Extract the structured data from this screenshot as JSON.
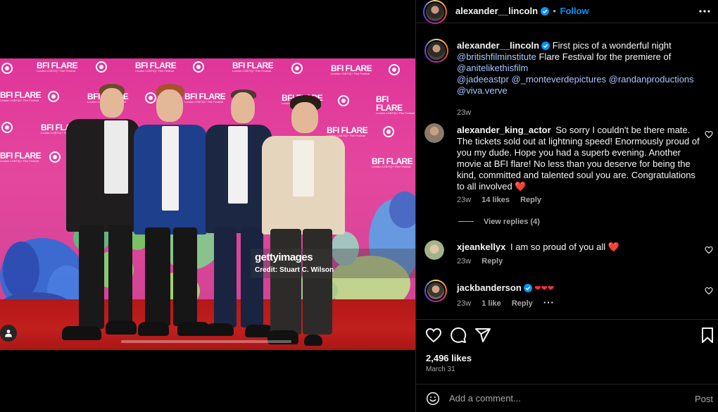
{
  "post": {
    "username": "alexander__lincoln",
    "follow_label": "Follow",
    "media": {
      "watermark_logo": "gettyimages",
      "watermark_credit": "Credit: Stuart C. Wilson",
      "backdrop_logo": "BFI FLARE"
    },
    "caption": {
      "username": "alexander__lincoln",
      "text_1": "First pics of a wonderful night",
      "mention_1": "@britishfilminstitute",
      "text_2": " Flare Festival for the premiere of",
      "mention_2": "@anitelikethisfilm",
      "mention_3": "@jadeeastpr",
      "mention_4": "@_monteverdepictures",
      "mention_5": "@randanproductions",
      "mention_6": "@viva.verve",
      "time": "23w"
    },
    "comments": [
      {
        "username": "alexander_king_actor",
        "text": "So sorry I couldn't be there mate. The tickets sold out at lightning speed! Enormously proud of you my dude. Hope you had a superb evening. Another movie at BFI flare! No less than you deserve for being the kind, committed and talented soul you are. Congratulations to all involved",
        "emoji": "❤️",
        "time": "23w",
        "likes": "14 likes",
        "reply": "Reply",
        "view_replies": "View replies (4)"
      },
      {
        "username": "xjeankellyx",
        "text": "I am so proud of you all",
        "emoji": "❤️",
        "time": "23w",
        "reply": "Reply"
      },
      {
        "username": "jackbanderson",
        "text": "❤❤❤",
        "time": "23w",
        "likes": "1 like",
        "reply": "Reply",
        "more": "···"
      }
    ],
    "likes_count": "2,496 likes",
    "date": "March 31",
    "composer": {
      "placeholder": "Add a comment...",
      "post_label": "Post"
    }
  },
  "colors": {
    "accent": "#0095f6",
    "mention": "#a9c7ff",
    "secondary_text": "#a8a8a8",
    "heart_red": "#ed4956"
  }
}
